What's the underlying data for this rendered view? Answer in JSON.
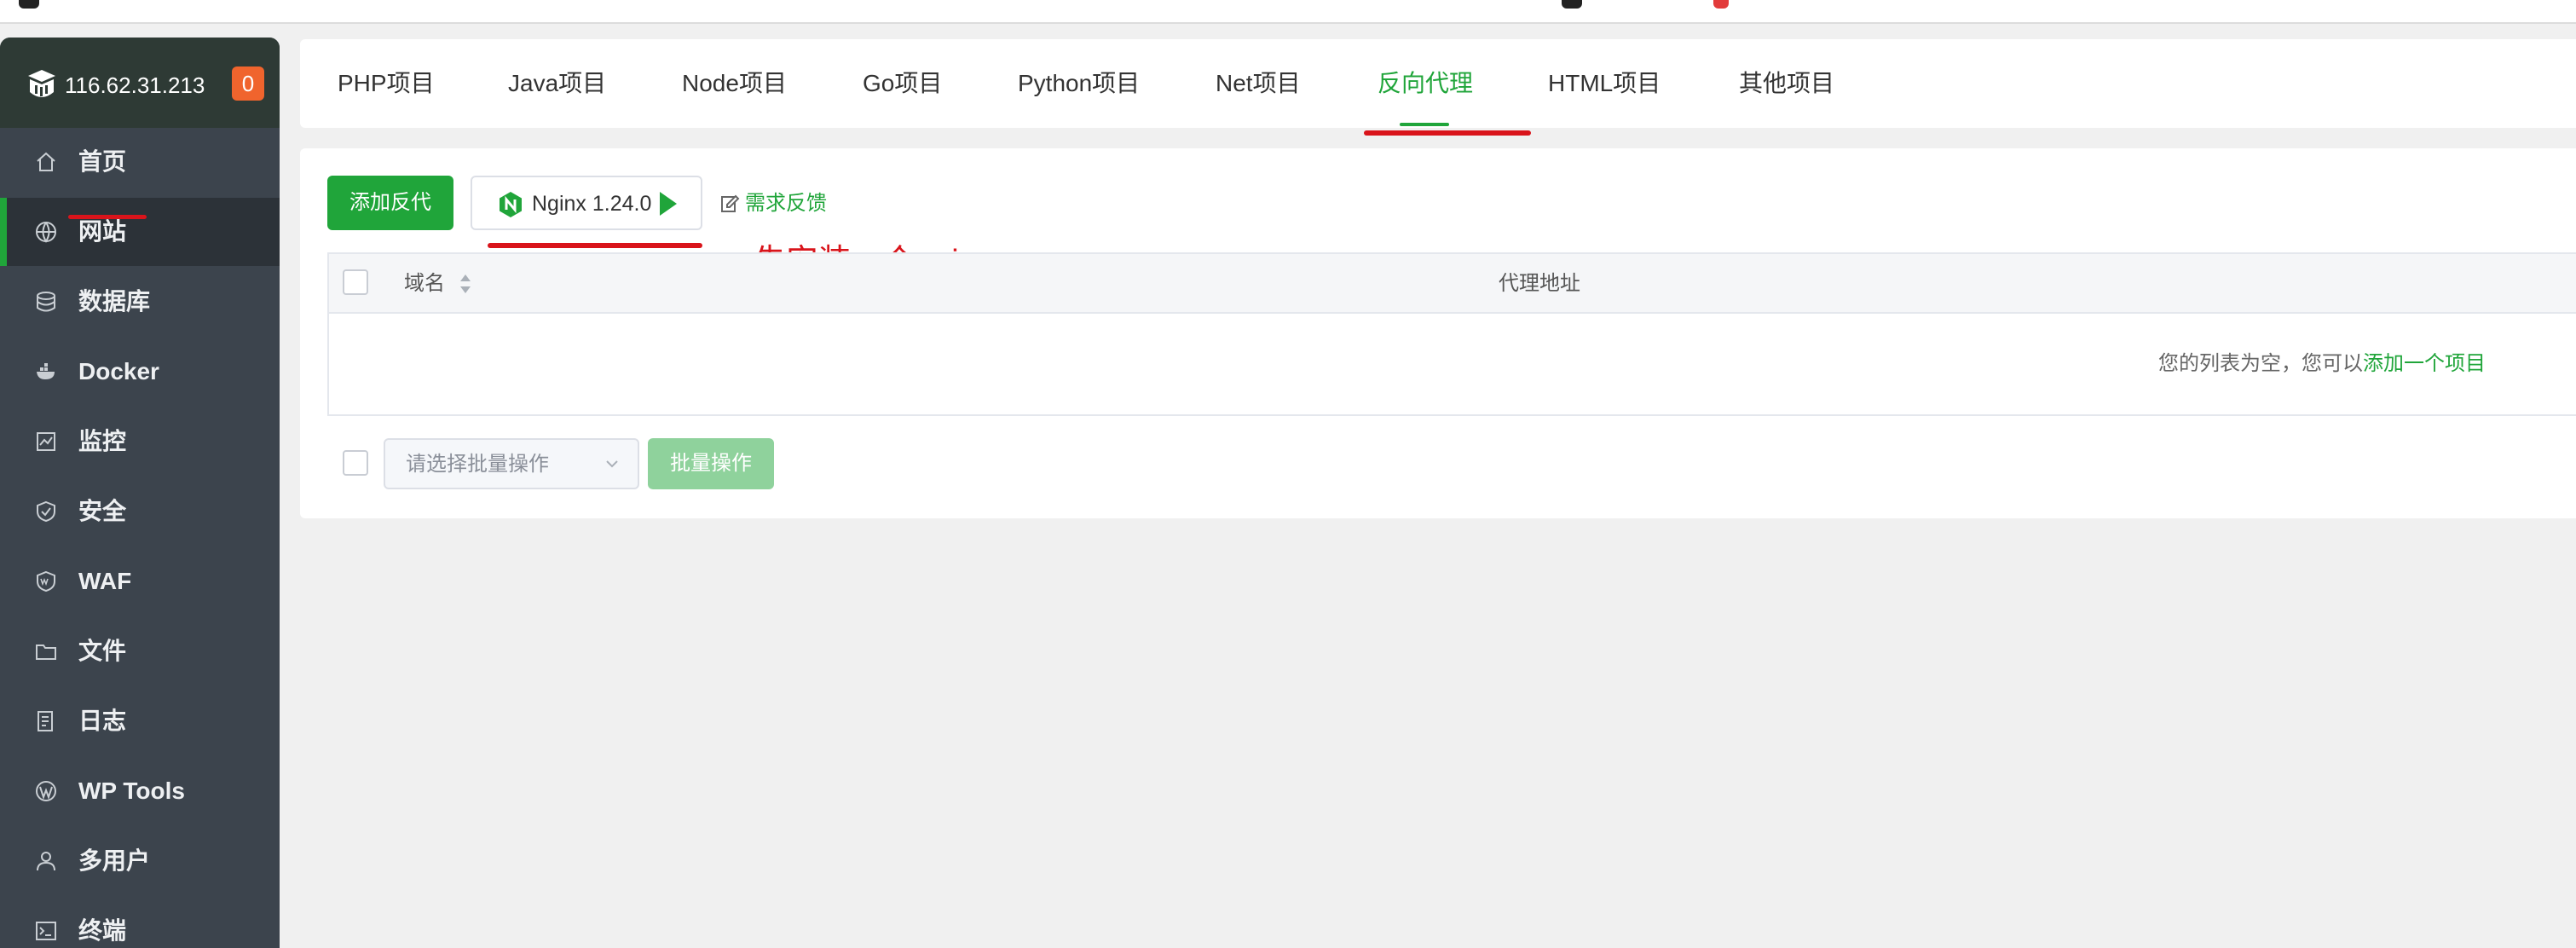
{
  "colors": {
    "accent": "#20a53a",
    "sidebar_bg": "#3c444d",
    "sidebar_header_bg": "#2e3a35",
    "badge": "#f0642d",
    "annotation_red": "#d9141b"
  },
  "sidebar": {
    "server_ip": "116.62.31.213",
    "badge_count": "0",
    "items": [
      {
        "label": "首页",
        "icon": "home-icon"
      },
      {
        "label": "网站",
        "icon": "globe-icon"
      },
      {
        "label": "数据库",
        "icon": "database-icon"
      },
      {
        "label": "Docker",
        "icon": "docker-icon"
      },
      {
        "label": "监控",
        "icon": "monitor-icon"
      },
      {
        "label": "安全",
        "icon": "shield-icon"
      },
      {
        "label": "WAF",
        "icon": "waf-icon"
      },
      {
        "label": "文件",
        "icon": "folder-icon"
      },
      {
        "label": "日志",
        "icon": "log-icon"
      },
      {
        "label": "WP Tools",
        "icon": "wordpress-icon"
      },
      {
        "label": "多用户",
        "icon": "users-icon"
      },
      {
        "label": "终端",
        "icon": "terminal-icon"
      }
    ],
    "active_index": 1
  },
  "tabs": {
    "items": [
      "PHP项目",
      "Java项目",
      "Node项目",
      "Go项目",
      "Python项目",
      "Net项目",
      "反向代理",
      "HTML项目",
      "其他项目"
    ],
    "active_index": 6
  },
  "toolbar": {
    "add_button": "添加反代",
    "nginx_button": "Nginx 1.24.0",
    "feedback": "需求反馈"
  },
  "annotation": "先安装一个nginx",
  "table": {
    "columns": [
      "域名",
      "代理地址"
    ],
    "empty_text": "您的列表为空，您可以",
    "empty_link": "添加一个项目"
  },
  "batch": {
    "select_placeholder": "请选择批量操作",
    "button": "批量操作"
  }
}
